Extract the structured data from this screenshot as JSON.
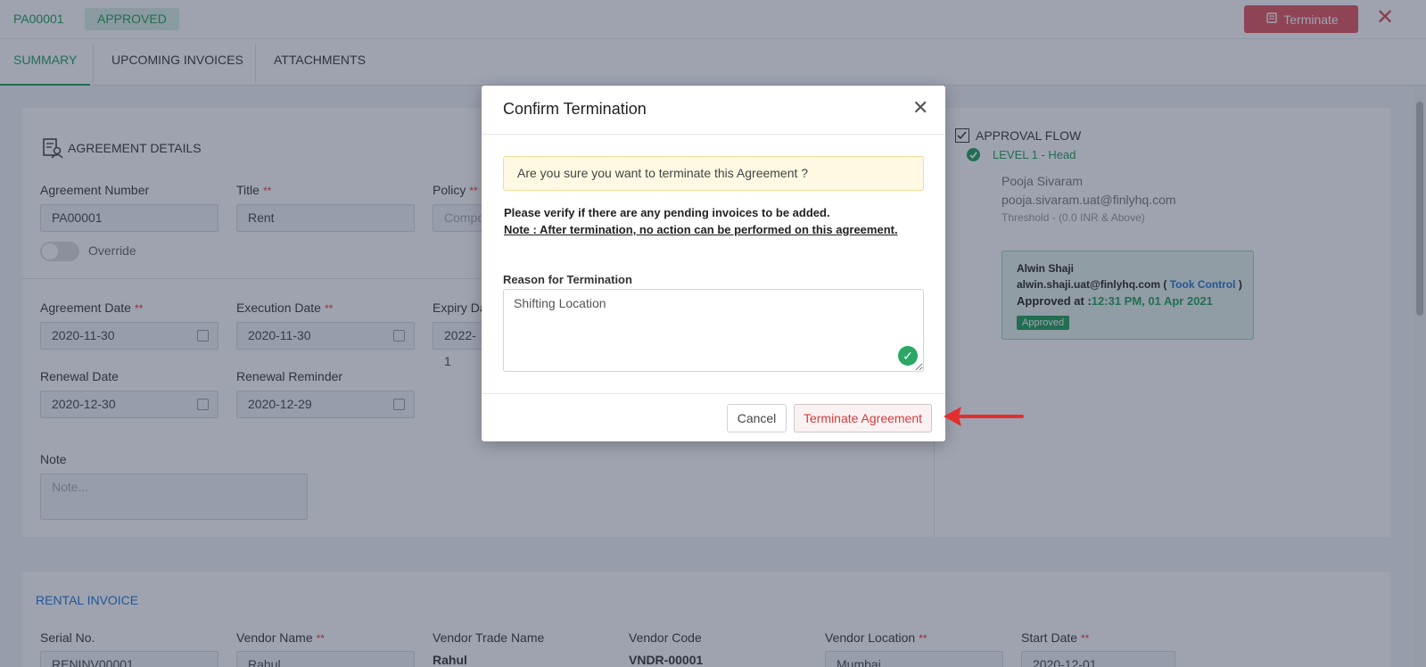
{
  "header": {
    "agreement_no": "PA00001",
    "status": "APPROVED",
    "terminate_label": "Terminate",
    "close_glyph": "✕"
  },
  "tabs": [
    {
      "label": "SUMMARY"
    },
    {
      "label": "UPCOMING INVOICES"
    },
    {
      "label": "ATTACHMENTS"
    }
  ],
  "agreement": {
    "section_title": "AGREEMENT DETAILS",
    "agreement_number_label": "Agreement Number",
    "agreement_number_value": "PA00001",
    "title_label": "Title",
    "title_value": "Rent",
    "policy_label": "Policy",
    "policy_value": "Compo",
    "override_label": "Override",
    "agreement_date_label": "Agreement Date",
    "agreement_date_value": "2020-11-30",
    "execution_date_label": "Execution Date",
    "execution_date_value": "2020-11-30",
    "expiry_label": "Expiry Da",
    "expiry_value": "2022-1",
    "renewal_date_label": "Renewal Date",
    "renewal_date_value": "2020-12-30",
    "renewal_reminder_label": "Renewal Reminder",
    "renewal_reminder_value": "2020-12-29",
    "note_label": "Note",
    "note_placeholder": "Note...",
    "required_mark": "**"
  },
  "approval": {
    "title": "APPROVAL FLOW",
    "level": "LEVEL 1  -  Head",
    "approver_name": "Pooja Sivaram",
    "approver_email": "pooja.sivaram.uat@finlyhq.com",
    "threshold": "Threshold -  (0.0 INR  & Above)",
    "card_name": "Alwin Shaji",
    "card_email_prefix": "alwin.shaji.uat@finlyhq.com ( ",
    "card_took_control": "Took Control",
    "card_email_suffix": " )",
    "card_approved_at_label": "Approved at :",
    "card_approved_at_value": "12:31 PM, 01 Apr 2021",
    "card_badge": "Approved"
  },
  "rental": {
    "section_title": "RENTAL INVOICE",
    "serial_label": "Serial No.",
    "serial_value": "RENINV00001",
    "vendor_name_label": "Vendor Name",
    "vendor_name_value": "Rahul",
    "vendor_trade_label": "Vendor Trade Name",
    "vendor_trade_value": "Rahul",
    "vendor_code_label": "Vendor Code",
    "vendor_code_value": "VNDR-00001",
    "vendor_location_label": "Vendor Location",
    "vendor_location_value": "Mumbai",
    "start_date_label": "Start Date",
    "start_date_value": "2020-12-01"
  },
  "modal": {
    "title": "Confirm Termination",
    "close_glyph": "✕",
    "warning": "Are you sure you want to terminate this Agreement ?",
    "verify_text": "Please verify if there are any pending invoices to be added.",
    "note_text": "Note : After termination, no action can be performed on this agreement.",
    "reason_label": "Reason for Termination",
    "reason_value": "Shifting Location",
    "cancel_label": "Cancel",
    "confirm_label": "Terminate Agreement"
  },
  "colors": {
    "accent_green": "#1e9e57",
    "danger_red": "#e4535b",
    "link_blue": "#1c74d9"
  }
}
